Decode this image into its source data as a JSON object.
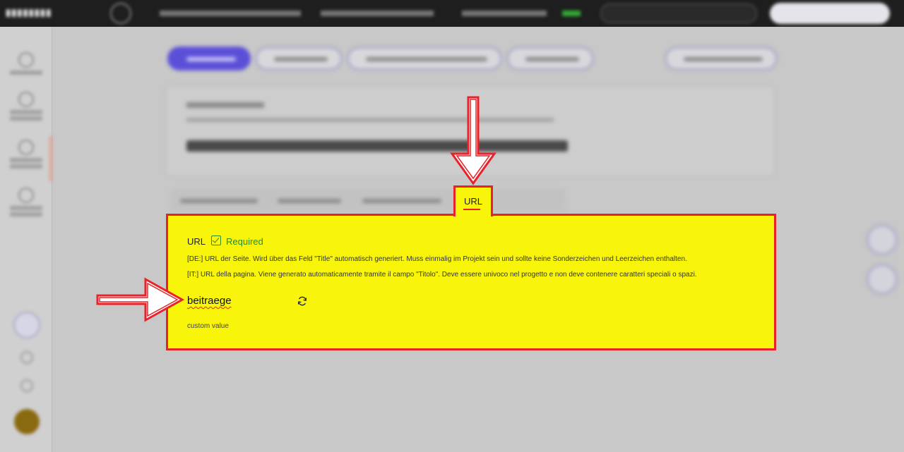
{
  "url_tab": {
    "label": "URL"
  },
  "field": {
    "label": "URL",
    "required_label": "Required",
    "description_de": "[DE:] URL der Seite. Wird über das Feld \"Title\" automatisch generiert. Muss einmalig im Projekt sein und sollte keine Sonderzeichen und Leerzeichen enthalten.",
    "description_it": "[IT:] URL della pagina. Viene generato automaticamente tramite il campo \"Titolo\". Deve essere univoco nel progetto e non deve contenere caratteri speciali o spazi.",
    "value": "beitraege",
    "hint": "custom value"
  },
  "colors": {
    "highlight": "#f8f50a",
    "annotation_red": "#e8222a",
    "required_green": "#2a8a2a",
    "primary": "#5b4fd8"
  },
  "icons": [
    "refresh-icon",
    "checkbox-checked-icon",
    "arrow-down-annotation",
    "arrow-right-annotation"
  ]
}
